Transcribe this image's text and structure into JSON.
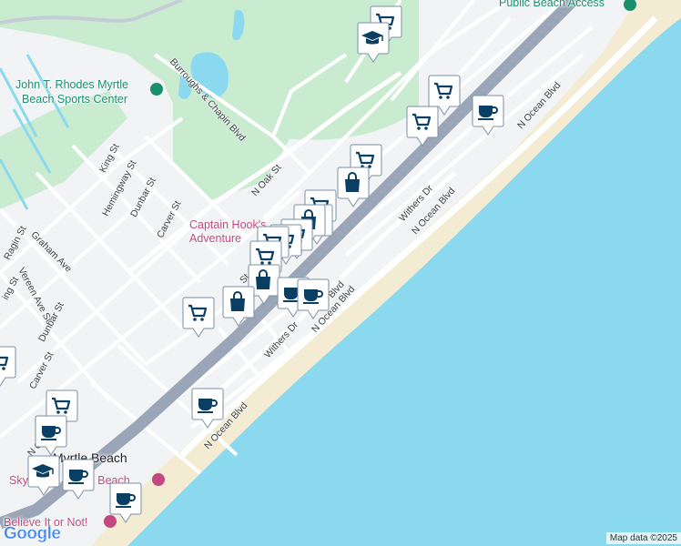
{
  "map": {
    "colors": {
      "land": "#f1f3f4",
      "park": "#c9ebd0",
      "water": "#8ad9ee",
      "highway": "#9aa6b8",
      "beach": "#f4ecd2",
      "marker": "#0b3e63",
      "poi_teal": "#1a8f6b",
      "poi_pink": "#c2487f"
    },
    "labels": {
      "public_beach_access": "Public Beach Access",
      "sports_center_line1": "John T. Rhodes Myrtle",
      "sports_center_line2": "Beach Sports Center",
      "captain_hooks_line1": "Captain Hook's",
      "captain_hooks_line2": "Adventure",
      "myrtle_beach": "Myrtle Beach",
      "sky_wheel": "SkyWheel Myrtle Beach",
      "believe_it": "Believe It or Not!"
    },
    "streets": {
      "burroughs_chapin": "Burroughs & Chapin Blvd",
      "n_oak": "N Oak St",
      "king": "King St",
      "hemingway": "Hemingway St",
      "dunbar_top": "Dunbar St",
      "carver_top": "Carver St",
      "graham": "Graham Ave",
      "ragin": "Ragin St",
      "vereen": "Vereen Ave St",
      "ming": "ing St",
      "dunbar_bottom": "Dunbar St",
      "carver_bottom": "Carver St",
      "withers_top": "Withers Dr",
      "withers_bottom": "Withers Dr",
      "n_ocean_top": "N Ocean Blvd",
      "n_ocean_mid": "N Ocean Blvd",
      "n_ocean_lower": "N Ocean Blvd",
      "n_ocean_bottom": "N Ocean Blvd",
      "n_ocean_partial": "N O",
      "blvd_partial": "Blvd",
      "st_partial": "St"
    },
    "markers": [
      {
        "name": "grocery",
        "icon": "cart"
      },
      {
        "name": "school",
        "icon": "cap"
      },
      {
        "name": "grocery",
        "icon": "cart"
      },
      {
        "name": "grocery",
        "icon": "cart"
      },
      {
        "name": "cafe",
        "icon": "cup"
      },
      {
        "name": "grocery",
        "icon": "cart"
      },
      {
        "name": "shopping",
        "icon": "bag"
      },
      {
        "name": "grocery",
        "icon": "cart"
      },
      {
        "name": "grocery",
        "icon": "cart"
      },
      {
        "name": "shopping",
        "icon": "bag"
      },
      {
        "name": "grocery",
        "icon": "cart"
      },
      {
        "name": "grocery",
        "icon": "cart"
      },
      {
        "name": "grocery",
        "icon": "cart"
      },
      {
        "name": "grocery",
        "icon": "cart"
      },
      {
        "name": "shopping",
        "icon": "bag"
      },
      {
        "name": "cafe",
        "icon": "cup"
      },
      {
        "name": "cafe",
        "icon": "cup"
      },
      {
        "name": "grocery",
        "icon": "cart"
      },
      {
        "name": "shopping",
        "icon": "bag"
      },
      {
        "name": "cafe",
        "icon": "cup"
      },
      {
        "name": "grocery",
        "icon": "cart"
      },
      {
        "name": "cafe",
        "icon": "cup"
      },
      {
        "name": "grocery",
        "icon": "cart"
      },
      {
        "name": "school",
        "icon": "cap"
      },
      {
        "name": "cafe",
        "icon": "cup"
      },
      {
        "name": "cafe",
        "icon": "cup"
      }
    ],
    "google_logo": "Google",
    "attribution": "Map data ©2025"
  }
}
